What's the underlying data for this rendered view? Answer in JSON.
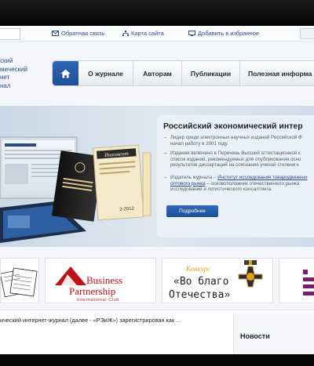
{
  "utility": {
    "feedback": "Обратная связь",
    "sitemap": "Карта сайта",
    "favorites": "Добавить в избранное"
  },
  "logo": {
    "lines": [
      "ский",
      "мический",
      "нет",
      "нал"
    ]
  },
  "nav": {
    "items": [
      "О журнале",
      "Авторам",
      "Публикации",
      "Полезная информа"
    ]
  },
  "hero": {
    "title": "Российский экономический интер",
    "bullet1": "Лидер среди электронных научных изданий Российской Ф начал работу в 2001 году.",
    "bullet2": "Издание включено в Перечень Высшей аттестационной к список изданий, рекомендуемых для опубликования осно результатов диссертаций на соискание ученой степени к",
    "bullet3_prefix": "Издатель журнала – ",
    "bullet3_link": "Институт исследования товародвижени оптового рынка",
    "bullet3_suffix": " – основоположник отечественного рынка исследований и логистического консалтинга.",
    "button": "Подробнее",
    "book1": "РОССИЙСКИЙ ЭКОНОМИЧЕСКИЙ ИНТЕРНЕТ-ЖУРНАЛ",
    "book2": "Инкомент",
    "book2_issue": "2-2012"
  },
  "partners": {
    "business_line1": "Business",
    "business_line2": "Partnership",
    "business_line3": "International Club",
    "contest_label": "Конкурс",
    "contest_line1": "«Во благо",
    "contest_line2": "Отечества»"
  },
  "content": {
    "text": "ический интернет-журнал (далее - «РЭиЖ») зарегистрирован как ... ",
    "news_title": "Новости"
  },
  "colors": {
    "brand": "#2b4d86",
    "nav_active": "#1f4f99",
    "business_red": "#c0111b"
  }
}
